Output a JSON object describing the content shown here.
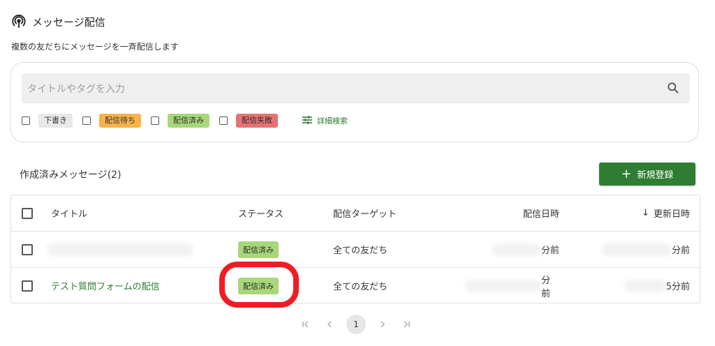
{
  "header": {
    "title": "メッセージ配信",
    "subtitle": "複数の友だちにメッセージを一斉配信します",
    "icon": "podcast-icon"
  },
  "search": {
    "placeholder": "タイトルやタグを入力",
    "value": ""
  },
  "filters": [
    {
      "label": "下書き",
      "color": "#e8e8e8"
    },
    {
      "label": "配信待ち",
      "color": "#f7b24a"
    },
    {
      "label": "配信済み",
      "color": "#a8d77a"
    },
    {
      "label": "配信失敗",
      "color": "#e57373"
    }
  ],
  "advanced_search_label": "詳細検索",
  "list": {
    "title": "作成済みメッセージ(2)",
    "new_button_label": "新規登録",
    "columns": [
      "タイトル",
      "ステータス",
      "配信ターゲット",
      "配信日時",
      "更新日時"
    ],
    "sort_indicator": "↓",
    "rows": [
      {
        "title": "",
        "status": "配信済み",
        "target": "全ての友だち",
        "date": "分前",
        "updated": "分前"
      },
      {
        "title": "テスト質問フォームの配信",
        "status": "配信済み",
        "target": "全ての友だち",
        "date": "分前",
        "updated": "5分前"
      }
    ]
  },
  "pagination": {
    "current": "1"
  },
  "colors": {
    "accent": "#2e7d32",
    "highlight": "#ef1c24"
  }
}
